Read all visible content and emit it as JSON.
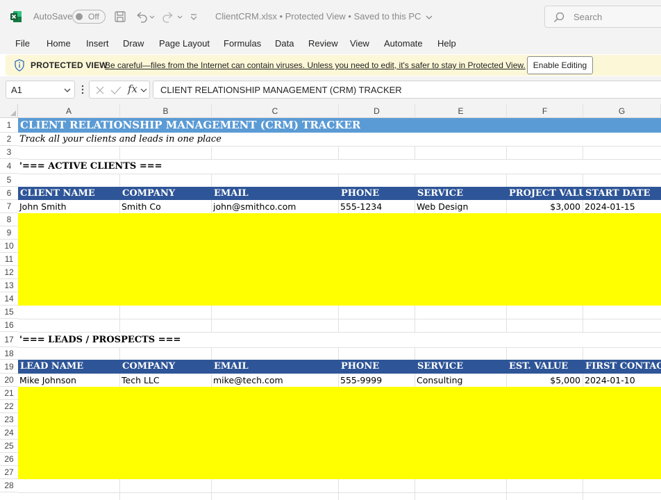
{
  "titlebar": {
    "autosave_label": "AutoSave",
    "autosave_state": "Off",
    "doc_title": "ClientCRM.xlsx  •  Protected View  •  Saved to this PC",
    "search_placeholder": "Search"
  },
  "menu": [
    "File",
    "Home",
    "Insert",
    "Draw",
    "Page Layout",
    "Formulas",
    "Data",
    "Review",
    "View",
    "Automate",
    "Help"
  ],
  "protected_view": {
    "title": "PROTECTED VIEW",
    "message": "Be careful—files from the Internet can contain viruses. Unless you need to edit, it's safer to stay in Protected View.",
    "button": "Enable Editing"
  },
  "formula_bar": {
    "cell_ref": "A1",
    "fx": "fx",
    "formula": "CLIENT RELATIONSHIP MANAGEMENT (CRM) TRACKER"
  },
  "columns": [
    "A",
    "B",
    "C",
    "D",
    "E",
    "F",
    "G"
  ],
  "rows": [
    "1",
    "2",
    "3",
    "4",
    "5",
    "6",
    "7",
    "8",
    "9",
    "10",
    "11",
    "12",
    "13",
    "14",
    "15",
    "16",
    "17",
    "18",
    "19",
    "20",
    "21",
    "22",
    "23",
    "24",
    "25",
    "26",
    "27",
    "28"
  ],
  "sheet": {
    "title": "CLIENT RELATIONSHIP MANAGEMENT (CRM) TRACKER",
    "subtitle": "Track all your clients and leads in one place",
    "active_section": "'=== ACTIVE CLIENTS ===",
    "active_headers": [
      "CLIENT NAME",
      "COMPANY",
      "EMAIL",
      "PHONE",
      "SERVICE",
      "PROJECT VALUE",
      "START DATE"
    ],
    "active_row": [
      "John Smith",
      "Smith Co",
      "john@smithco.com",
      "555-1234",
      "Web Design",
      "$3,000",
      "2024-01-15"
    ],
    "leads_section": "'=== LEADS / PROSPECTS ===",
    "leads_headers": [
      "LEAD NAME",
      "COMPANY",
      "EMAIL",
      "PHONE",
      "SERVICE",
      "EST. VALUE",
      "FIRST CONTACT"
    ],
    "leads_row": [
      "Mike Johnson",
      "Tech LLC",
      "mike@tech.com",
      "555-9999",
      "Consulting",
      "$5,000",
      "2024-01-10"
    ]
  },
  "colors": {
    "title_fill": "#5b9bd5",
    "header_fill": "#2e5597",
    "highlight_fill": "#ffff00",
    "protected_bar": "#fcf7d7",
    "excel_green": "#107c41"
  }
}
